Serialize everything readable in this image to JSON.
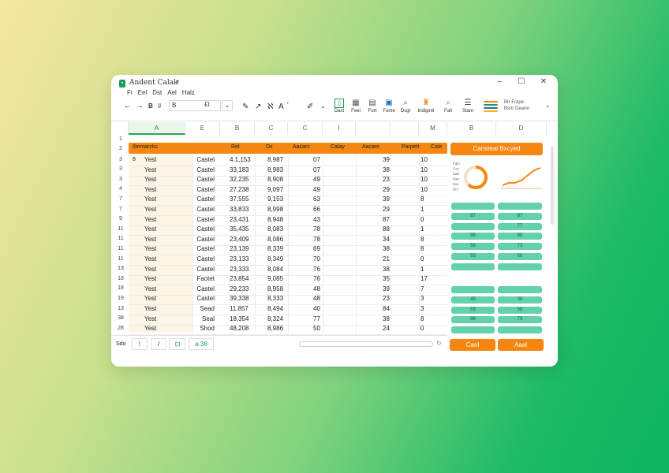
{
  "window": {
    "title": "Andent Calak",
    "menu": [
      "Fi",
      "Eel",
      "Dst",
      "Ael",
      "Halz"
    ]
  },
  "toolbar": {
    "undo": "←",
    "redo": "→",
    "bold": "B",
    "italic": "Ii",
    "font_box": "B",
    "size_box": "£t",
    "tools": [
      "✎",
      "↗",
      "ℵ",
      "A",
      "⁺",
      "✐"
    ]
  },
  "ribbon": [
    {
      "label": "Dast",
      "icon": "chart-icon",
      "color": "#1b9b55"
    },
    {
      "label": "Feel",
      "icon": "table-icon",
      "color": "#555555"
    },
    {
      "label": "Fort",
      "icon": "format-icon",
      "color": "#555555"
    },
    {
      "label": "Fome",
      "icon": "grid-icon",
      "color": "#1f6fb5"
    },
    {
      "label": "Dsgt",
      "icon": "search-icon",
      "color": "#1f6fb5"
    },
    {
      "label": "Indigirel",
      "icon": "insight-icon",
      "color": "#f5860f"
    },
    {
      "label": "Falt",
      "icon": "find-icon",
      "color": "#1b9b55"
    },
    {
      "label": "Stam",
      "icon": "sort-icon",
      "color": "#444444"
    }
  ],
  "ribbon_extra": {
    "line1": "Btr  Frape",
    "line2": "Bsnr  Deane"
  },
  "columns": [
    "A",
    "E",
    "B",
    "C",
    "C",
    "I",
    "",
    "",
    "",
    "M"
  ],
  "panel_columns": [
    "B",
    "D"
  ],
  "header_row": [
    "Iltemarcks",
    "Rel",
    "Dx",
    "Aacarc",
    "Calay",
    "Aacare",
    "Parpett",
    "Cale"
  ],
  "rows": [
    {
      "num": "3",
      "a": "Yest",
      "b": "Castel",
      "c": "4.1,153",
      "d": "8,987",
      "e": "07",
      "f": "39",
      "g": "10",
      "mark": "8"
    },
    {
      "num": "3",
      "a": "Yest",
      "b": "Castel",
      "c": "33,183",
      "d": "8,983",
      "e": "07",
      "f": "38",
      "g": "10",
      "mark": ""
    },
    {
      "num": "3",
      "a": "Yest",
      "b": "Castel",
      "c": "32,235",
      "d": "8,908",
      "e": "49",
      "f": "23",
      "g": "10",
      "mark": ""
    },
    {
      "num": "4",
      "a": "Yest",
      "b": "Castel",
      "c": "27,238",
      "d": "9,097",
      "e": "49",
      "f": "29",
      "g": "10",
      "mark": ""
    },
    {
      "num": "7",
      "a": "Yest",
      "b": "Castel",
      "c": "37,555",
      "d": "9,153",
      "e": "63",
      "f": "39",
      "g": "8",
      "mark": ""
    },
    {
      "num": "7",
      "a": "Yest",
      "b": "Castel",
      "c": "33,833",
      "d": "8,998",
      "e": "66",
      "f": "29",
      "g": "1",
      "mark": ""
    },
    {
      "num": "9",
      "a": "Yest",
      "b": "Castel",
      "c": "23,431",
      "d": "8,948",
      "e": "43",
      "f": "87",
      "g": "0",
      "mark": ""
    },
    {
      "num": "11",
      "a": "Yest",
      "b": "Castel",
      "c": "35,435",
      "d": "8,083",
      "e": "78",
      "f": "88",
      "g": "1",
      "mark": ""
    },
    {
      "num": "11",
      "a": "Yest",
      "b": "Castel",
      "c": "23,409",
      "d": "8,086",
      "e": "78",
      "f": "34",
      "g": "8",
      "mark": ""
    },
    {
      "num": "11",
      "a": "Yest",
      "b": "Castel",
      "c": "23,139",
      "d": "8,339",
      "e": "69",
      "f": "38",
      "g": "8",
      "mark": ""
    },
    {
      "num": "11",
      "a": "Yest",
      "b": "Castel",
      "c": "23,133",
      "d": "8,349",
      "e": "70",
      "f": "21",
      "g": "0",
      "mark": ""
    },
    {
      "num": "13",
      "a": "Yest",
      "b": "Castel",
      "c": "23,333",
      "d": "8,084",
      "e": "76",
      "f": "38",
      "g": "1",
      "mark": ""
    },
    {
      "num": "18",
      "a": "Yest",
      "b": "Faotet",
      "c": "23,854",
      "d": "9,085",
      "e": "76",
      "f": "35",
      "g": "17",
      "mark": ""
    },
    {
      "num": "18",
      "a": "Yest",
      "b": "Castel",
      "c": "29,233",
      "d": "8,958",
      "e": "48",
      "f": "39",
      "g": "7",
      "mark": ""
    },
    {
      "num": "19",
      "a": "Yest",
      "b": "Castel",
      "c": "39,338",
      "d": "8,333",
      "e": "48",
      "f": "23",
      "g": "3",
      "mark": ""
    },
    {
      "num": "13",
      "a": "Yest",
      "b": "Sead",
      "c": "11,857",
      "d": "8,494",
      "e": "40",
      "f": "84",
      "g": "3",
      "mark": ""
    },
    {
      "num": "38",
      "a": "Yest",
      "b": "Seal",
      "c": "18,354",
      "d": "8,324",
      "e": "77",
      "f": "38",
      "g": "8",
      "mark": ""
    },
    {
      "num": "28",
      "a": "Yest",
      "b": "Shod",
      "c": "48,208",
      "d": "8,986",
      "e": "50",
      "f": "24",
      "g": "0",
      "mark": ""
    }
  ],
  "panel": {
    "title": "Cansteal Bxcyed",
    "donut_labels": [
      "Faln",
      "Cac",
      "Sab",
      "Pae",
      "Sac",
      "Dm"
    ],
    "donut_percent": 0.62,
    "trend_values": [
      2,
      3,
      3,
      4,
      6,
      8,
      9
    ],
    "pills_top": [
      [
        "",
        ""
      ],
      [
        "87",
        "87"
      ],
      [
        "",
        "77"
      ],
      [
        "98",
        "98"
      ],
      [
        "58",
        "73"
      ],
      [
        "59",
        "58"
      ],
      [
        "",
        ""
      ]
    ],
    "pills_bottom": [
      [
        "",
        ""
      ],
      [
        "49",
        "38"
      ],
      [
        "59",
        "58"
      ],
      [
        "86",
        "79"
      ],
      [
        "",
        ""
      ]
    ],
    "cancel_label": "Canl",
    "apply_label": "Aaal"
  },
  "footer": {
    "sheet_label": "Sdo",
    "btn1": "!",
    "btn2": "/",
    "btn3": "⊡",
    "btn4": "a 38",
    "scroll_glyph": "↻"
  },
  "colors": {
    "accent": "#f5860f",
    "green": "#1b9b55",
    "mint": "#63d1ac"
  }
}
